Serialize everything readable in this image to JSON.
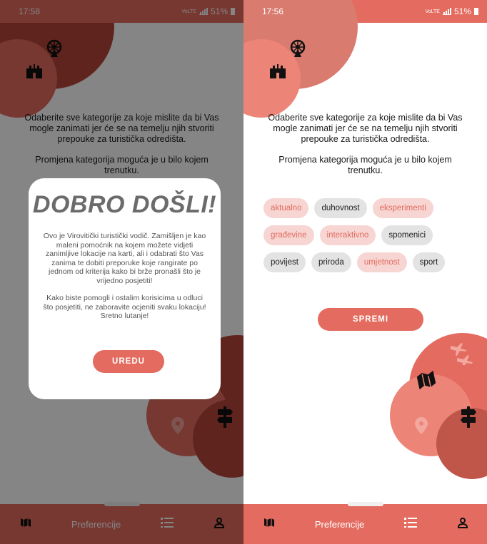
{
  "status_left": {
    "time": "17:58",
    "battery": "51%",
    "net": "VoLTE"
  },
  "status_right": {
    "time": "17:56",
    "battery": "51%",
    "net": "VoLTE"
  },
  "intro": {
    "line1": "Odaberite sve kategorije za koje mislite da bi Vas mogle zanimati jer će se na temelju njih stvoriti prepouke za turistička odredišta.",
    "line2": "Promjena kategorija moguća je u bilo kojem trenutku."
  },
  "categories": [
    {
      "label": "aktualno",
      "selected": true
    },
    {
      "label": "duhovnost",
      "selected": false
    },
    {
      "label": "eksperimenti",
      "selected": true
    },
    {
      "label": "građevine",
      "selected": true
    },
    {
      "label": "interaktivno",
      "selected": true
    },
    {
      "label": "spomenici",
      "selected": false
    },
    {
      "label": "povijest",
      "selected": false
    },
    {
      "label": "priroda",
      "selected": false
    },
    {
      "label": "umjetnost",
      "selected": true
    },
    {
      "label": "sport",
      "selected": false
    }
  ],
  "save_button": "SPREMI",
  "dialog": {
    "title": "DOBRO DOŠLI!",
    "para1": "Ovo je Virovitički turistički vodič. Zamišljen je kao maleni pomoćnik na kojem možete vidjeti zanimljive lokacije na karti, ali i odabrati što Vas zanima te dobiti preporuke koje rangirate po jednom od kriterija kako bi brže pronašli što je vrijedno posjetiti!",
    "para2": "Kako biste pomogli i ostalim korisicima u odluci što posjetiti, ne zaboravite ocjeniti svaku lokaciju!",
    "para3": "Sretno lutanje!",
    "ok_button": "UREDU"
  },
  "nav": {
    "preferences_label": "Preferencije"
  },
  "colors": {
    "accent": "#e46b5f",
    "accent_dark": "#b9463b",
    "chip_selected_bg": "#f6d5d2",
    "chip_unselected_bg": "#e3e3e3"
  },
  "icons": [
    "ferris-wheel-icon",
    "castle-icon",
    "map-icon",
    "location-pin-icon",
    "signpost-icon",
    "airplane-icon",
    "list-icon",
    "user-icon"
  ]
}
